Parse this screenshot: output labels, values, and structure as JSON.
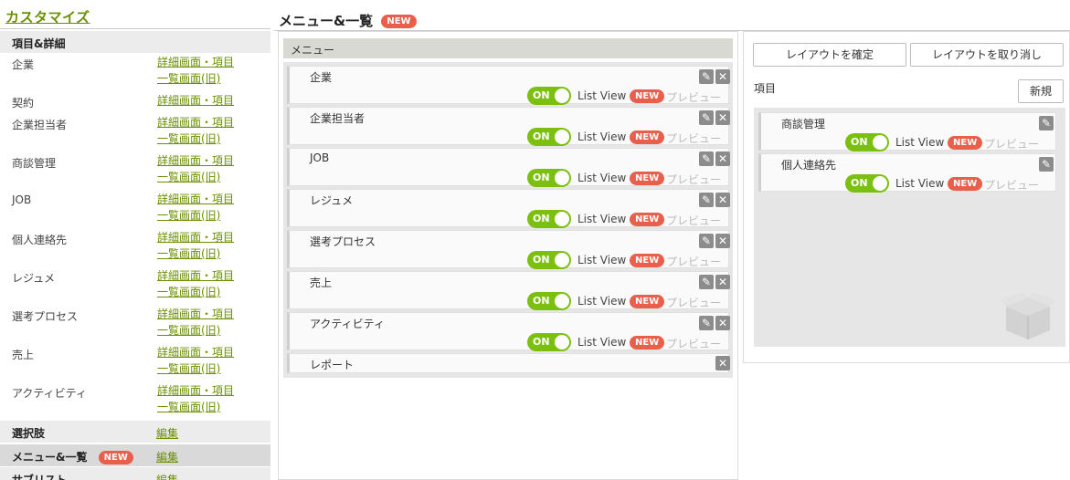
{
  "sidebar": {
    "title": "カスタマイズ",
    "sections": {
      "items_header": "項目&詳細",
      "options_header": "選択肢",
      "options_link": "編集",
      "menu_header": "メニュー&一覧",
      "menu_badge": "NEW",
      "menu_link": "編集",
      "sublist_header": "サブリスト",
      "sublist_link": "編集"
    },
    "items": [
      {
        "name": "企業",
        "link1": "詳細画面・項目",
        "link2": "一覧画面(旧)"
      },
      {
        "name": "契約",
        "link1": "詳細画面・項目",
        "link2": ""
      },
      {
        "name": "企業担当者",
        "link1": "詳細画面・項目",
        "link2": "一覧画面(旧)"
      },
      {
        "name": "商談管理",
        "link1": "詳細画面・項目",
        "link2": "一覧画面(旧)"
      },
      {
        "name": "JOB",
        "link1": "詳細画面・項目",
        "link2": "一覧画面(旧)"
      },
      {
        "name": "個人連絡先",
        "link1": "詳細画面・項目",
        "link2": "一覧画面(旧)"
      },
      {
        "name": "レジュメ",
        "link1": "詳細画面・項目",
        "link2": "一覧画面(旧)"
      },
      {
        "name": "選考プロセス",
        "link1": "詳細画面・項目",
        "link2": "一覧画面(旧)"
      },
      {
        "name": "売上",
        "link1": "詳細画面・項目",
        "link2": "一覧画面(旧)"
      },
      {
        "name": "アクティビティ",
        "link1": "詳細画面・項目",
        "link2": "一覧画面(旧)"
      }
    ]
  },
  "main": {
    "title": "メニュー&一覧",
    "title_badge": "NEW"
  },
  "menu_panel": {
    "header": "メニュー",
    "toggle_label": "ON",
    "list_view_label": "List View",
    "new_badge": "NEW",
    "preview_label": "プレビュー",
    "items": [
      {
        "name": "企業"
      },
      {
        "name": "企業担当者"
      },
      {
        "name": "JOB"
      },
      {
        "name": "レジュメ"
      },
      {
        "name": "選考プロセス"
      },
      {
        "name": "売上"
      },
      {
        "name": "アクティビティ"
      }
    ],
    "report_item": "レポート"
  },
  "right_panel": {
    "confirm_button": "レイアウトを確定",
    "cancel_button": "レイアウトを取り消し",
    "items_label": "項目",
    "new_button": "新規",
    "items": [
      {
        "name": "商談管理"
      },
      {
        "name": "個人連絡先"
      }
    ]
  },
  "colors": {
    "accent_green": "#7bbf0f",
    "link_green": "#6b8f00",
    "badge_red": "#e8604c"
  },
  "icons": [
    "pencil-icon",
    "close-icon",
    "box-icon"
  ]
}
